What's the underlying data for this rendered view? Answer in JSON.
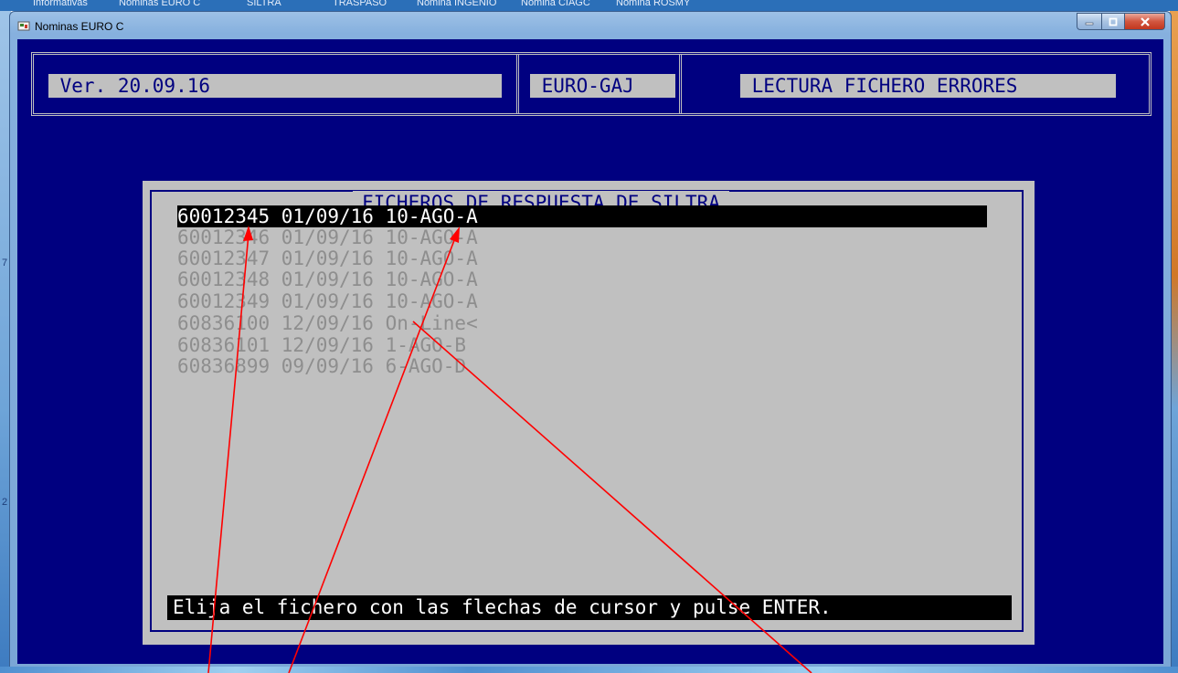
{
  "taskbar": {
    "items": [
      "Informativas",
      "Nominas EURO C",
      "SILTRA",
      "TRASPASO",
      "Nomina INGENIO",
      "Nomina CIAGC",
      "Nomina ROSMY"
    ]
  },
  "window": {
    "title": "Nominas EURO C",
    "icon": "app-icon"
  },
  "header": {
    "version": " Ver. 20.09.16",
    "company": " EURO-GAJ",
    "mode": " LECTURA FICHERO ERRORES"
  },
  "dialog": {
    "title": "FICHEROS DE RESPUESTA DE SILTRA",
    "files": [
      {
        "text": "60012345 01/09/16 10-AGO-A",
        "selected": true
      },
      {
        "text": "60012346 01/09/16 10-AGO-A",
        "selected": false
      },
      {
        "text": "60012347 01/09/16 10-AGO-A",
        "selected": false
      },
      {
        "text": "60012348 01/09/16 10-AGO-A",
        "selected": false
      },
      {
        "text": "60012349 01/09/16 10-AGO-A",
        "selected": false
      },
      {
        "text": "60836100 12/09/16 On-Line<",
        "selected": false
      },
      {
        "text": "60836101 12/09/16 1-AGO-B",
        "selected": false
      },
      {
        "text": "60836899 09/09/16 6-AGO-D",
        "selected": false
      }
    ],
    "status": "Elija el fichero con las flechas de cursor y pulse ENTER."
  },
  "desktop": {
    "left_marks": [
      "7",
      "2"
    ]
  },
  "colors": {
    "console_bg": "#000080",
    "field_bg": "#c0c0c0",
    "selected_bg": "#000000",
    "annotation": "#ff0000"
  }
}
